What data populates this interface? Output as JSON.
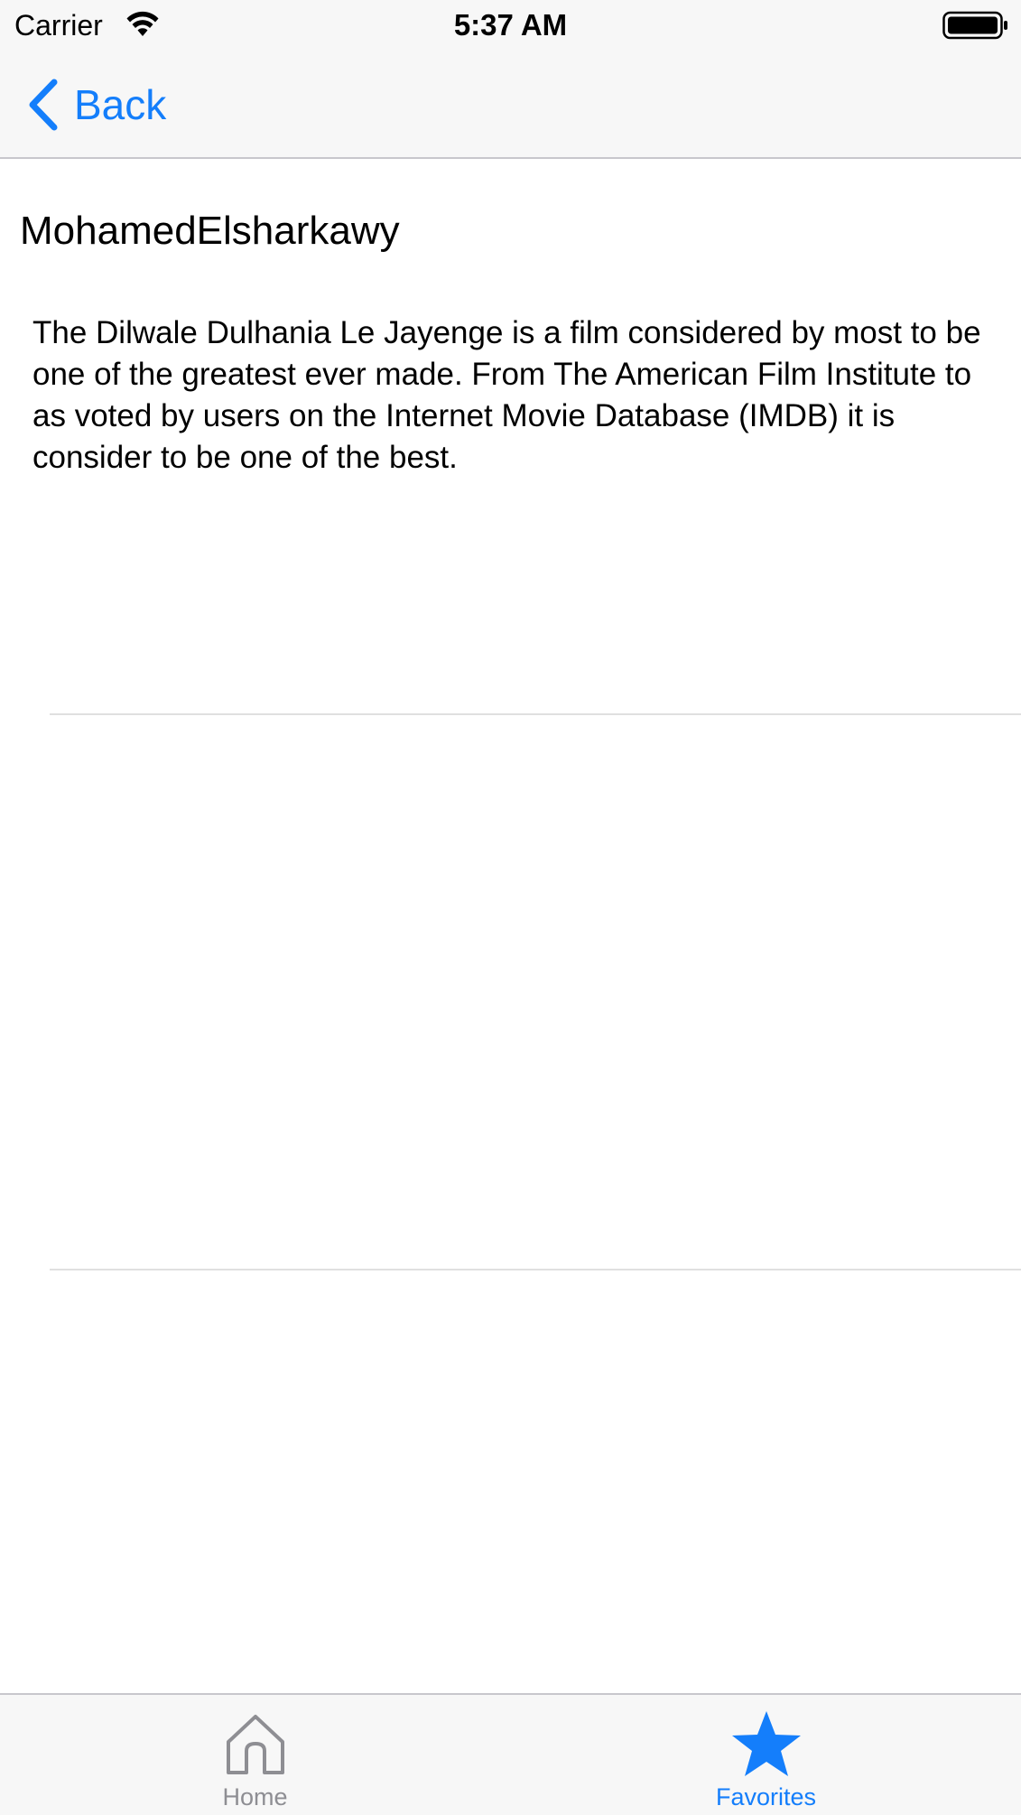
{
  "status_bar": {
    "carrier": "Carrier",
    "time": "5:37 AM",
    "wifi_icon": "wifi-icon",
    "battery_icon": "battery-icon"
  },
  "nav_bar": {
    "back_label": "Back",
    "back_icon": "chevron-left-icon",
    "accent_color": "#147efb"
  },
  "content": {
    "author": "MohamedElsharkawy",
    "description": "The Dilwale Dulhania Le Jayenge is a film considered by most to be one of the greatest ever made. From The American Film Institute to as voted by users on the Internet Movie Database (IMDB) it is consider to be one of the best."
  },
  "tab_bar": {
    "tabs": [
      {
        "label": "Home",
        "icon": "home-icon",
        "selected": false,
        "color": "#8e8e93"
      },
      {
        "label": "Favorites",
        "icon": "star-icon",
        "selected": true,
        "color": "#147efb"
      }
    ]
  }
}
